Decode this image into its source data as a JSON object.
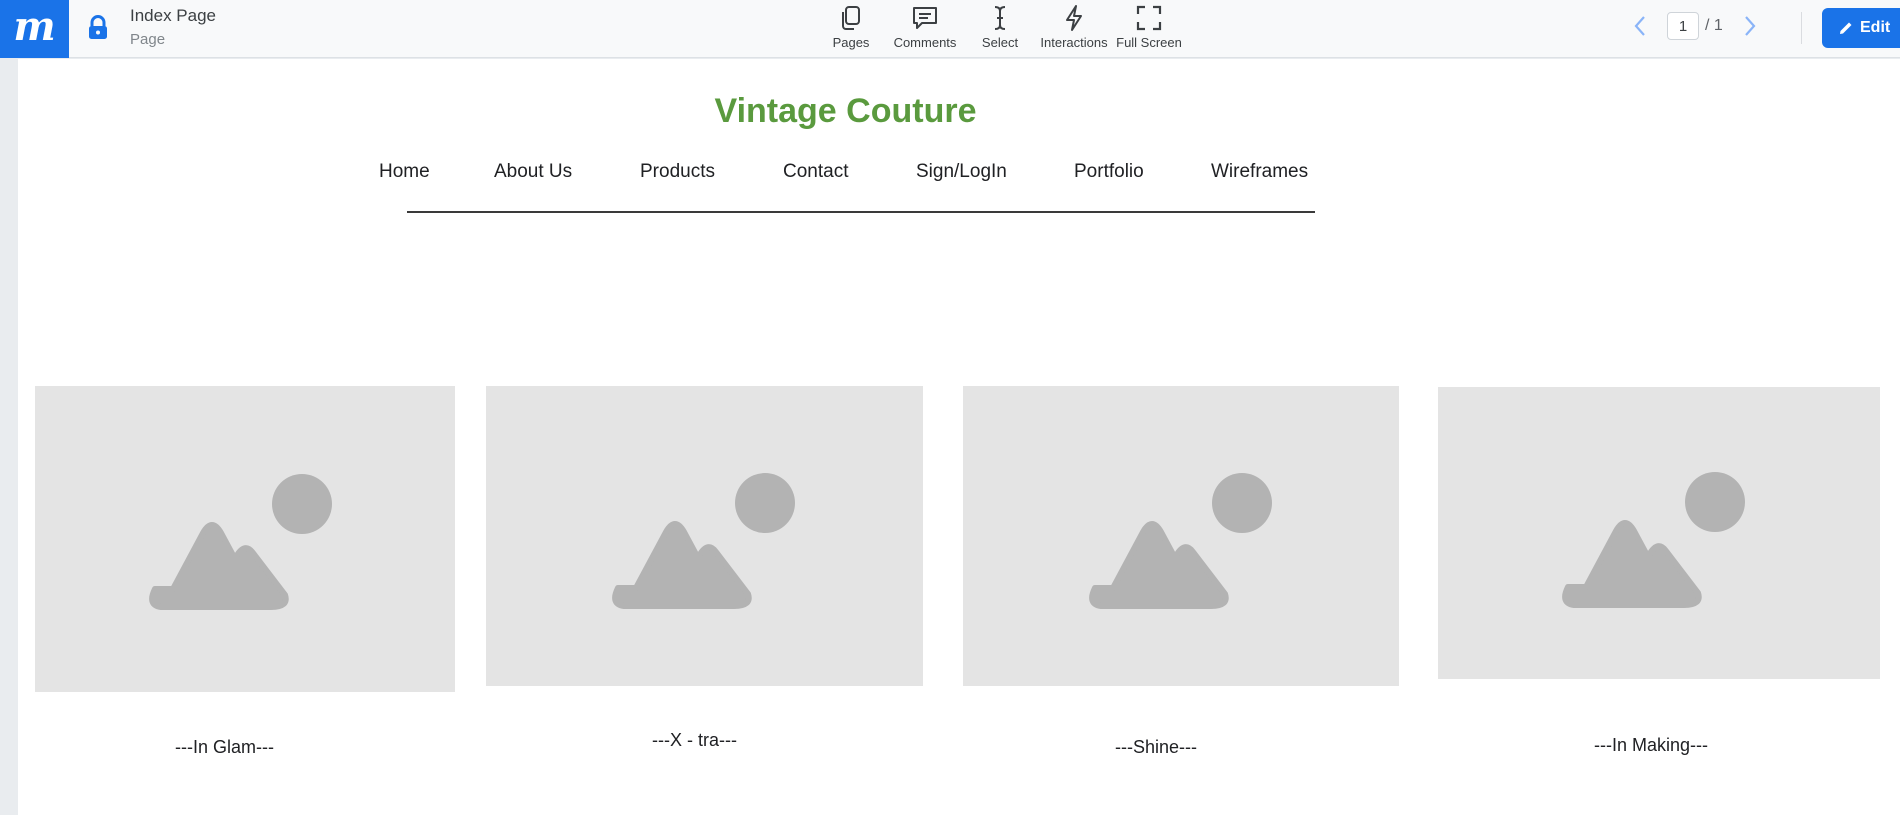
{
  "toolbar": {
    "logo": "m",
    "page_title": "Index Page",
    "page_subtitle": "Page",
    "tools": {
      "pages": "Pages",
      "comments": "Comments",
      "select": "Select",
      "interactions": "Interactions",
      "fullscreen": "Full Screen"
    },
    "pager": {
      "current": "1",
      "total": "/ 1"
    },
    "edit_label": "Edit"
  },
  "site": {
    "title": "Vintage Couture",
    "nav": [
      "Home",
      "About Us",
      "Products",
      "Contact",
      "Sign/LogIn",
      "Portfolio",
      "Wireframes"
    ]
  },
  "cards": [
    {
      "caption": "---In Glam---",
      "icon": "image-placeholder-icon"
    },
    {
      "caption": "---X - tra---",
      "icon": "image-placeholder-icon"
    },
    {
      "caption": "---Shine---",
      "icon": "image-placeholder-icon"
    },
    {
      "caption": "---In Making---",
      "icon": "image-placeholder-icon"
    }
  ],
  "colors": {
    "brand_blue": "#1a73e8",
    "title_green": "#5a9a3e",
    "placeholder_bg": "#e4e4e4",
    "placeholder_shape": "#b3b3b3"
  }
}
